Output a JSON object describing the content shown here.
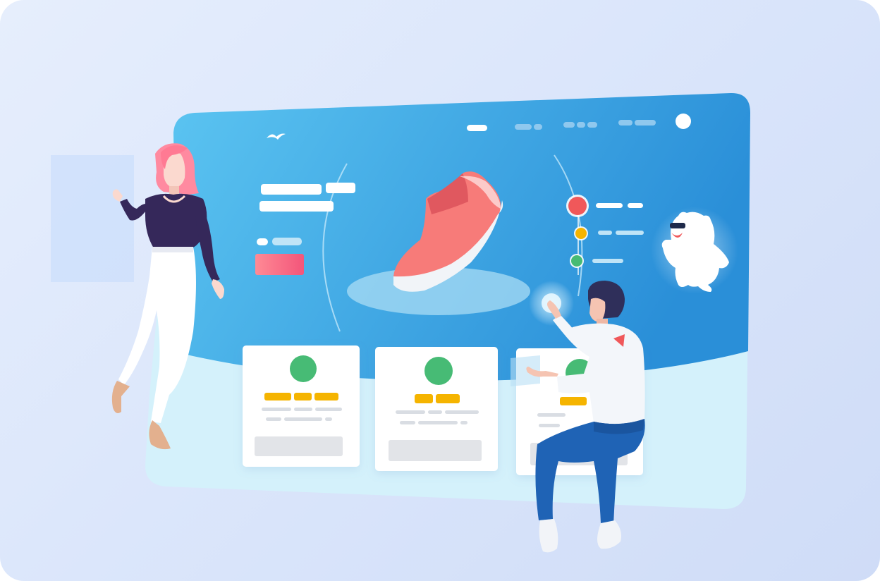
{
  "illustration": {
    "scene": "ecommerce-product-screen",
    "colors": {
      "background": "#dce7fb",
      "screen_top": "#2f9fe0",
      "screen_bottom": "#d6f3fb",
      "accent_red": "#f0585a",
      "accent_yellow": "#f5b400",
      "accent_green": "#46bb74",
      "cta_gradient_start": "#ff7d8d",
      "cta_gradient_end": "#f6577a",
      "shoe_pink": "#f77b79",
      "woman_hair": "#ff7a93",
      "woman_top": "#35285a",
      "man_pants": "#1f63b5"
    },
    "icons": [
      "logo-bird-icon",
      "profile-circle-icon",
      "shoe-product-icon",
      "timeline-step-icon",
      "bear-mascot-icon"
    ],
    "cards_count": 3
  }
}
